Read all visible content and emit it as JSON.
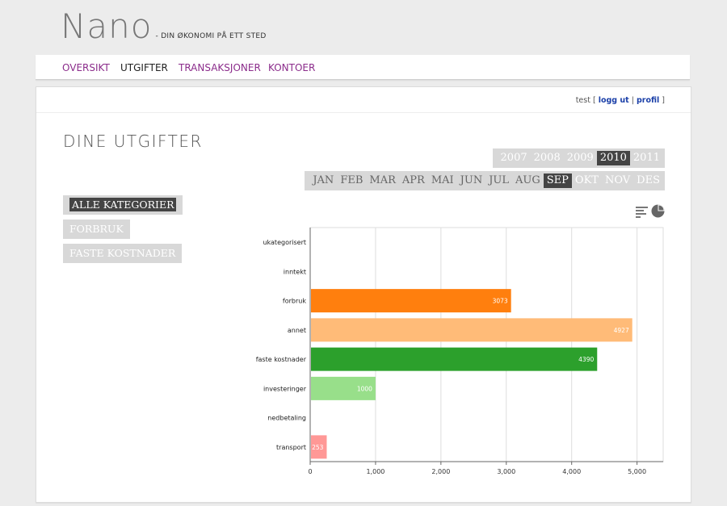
{
  "app": {
    "logo": "Nano",
    "tagline": "- DIN ØKONOMI PÅ ETT STED"
  },
  "nav": {
    "items": [
      {
        "label": "OVERSIKT",
        "active": false
      },
      {
        "label": "UTGIFTER",
        "active": true
      },
      {
        "label": "TRANSAKSJONER",
        "active": false
      },
      {
        "label": "KONTOER",
        "active": false
      }
    ]
  },
  "userbar": {
    "username": "test",
    "logout": "logg ut",
    "profile": "profil"
  },
  "page": {
    "title": "DINE UTGIFTER"
  },
  "years": [
    "2007",
    "2008",
    "2009",
    "2010",
    "2011"
  ],
  "selected_year": "2010",
  "months": [
    "JAN",
    "FEB",
    "MAR",
    "APR",
    "MAI",
    "JUN",
    "JUL",
    "AUG",
    "SEP",
    "OKT",
    "NOV",
    "DES"
  ],
  "selected_month": "SEP",
  "month_available_upto": "SEP",
  "categories_filter": [
    {
      "label": "ALLE KATEGORIER",
      "active": true
    },
    {
      "label": "FORBRUK",
      "active": false
    },
    {
      "label": "FASTE KOSTNADER",
      "active": false
    }
  ],
  "view_icons": [
    "bar-chart-icon",
    "pie-chart-icon"
  ],
  "chart_data": {
    "type": "bar",
    "orientation": "horizontal",
    "categories": [
      "ukategorisert",
      "inntekt",
      "forbruk",
      "annet",
      "faste kostnader",
      "investeringer",
      "nedbetaling",
      "transport"
    ],
    "values": [
      0,
      0,
      3073,
      4927,
      4390,
      1000,
      0,
      253
    ],
    "colors": [
      "#1f77b4",
      "#aec7e8",
      "#ff7f0e",
      "#ffbb78",
      "#2ca02c",
      "#98df8a",
      "#d62728",
      "#ff9896"
    ],
    "xticks": [
      "0",
      "1,000",
      "2,000",
      "3,000",
      "4,000",
      "5,000"
    ],
    "xlim": [
      0,
      5400
    ],
    "grid": true
  }
}
